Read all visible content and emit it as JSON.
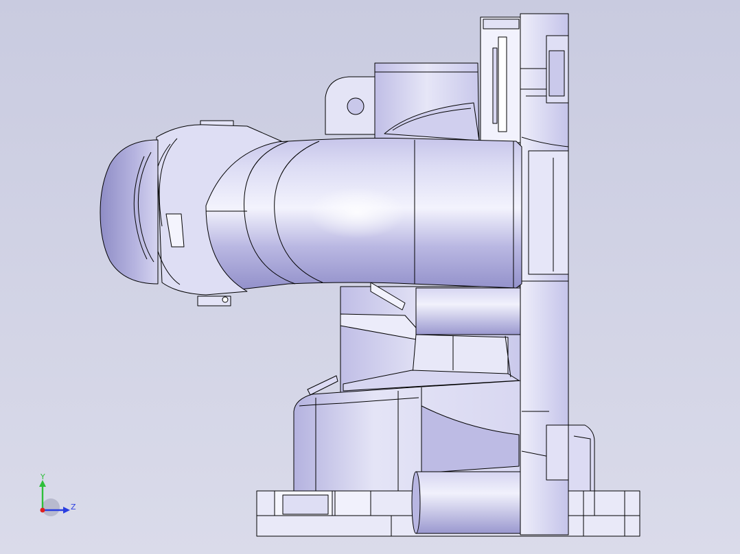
{
  "viewport": {
    "background_top": "#c9cbe0",
    "background_bottom": "#dadbea"
  },
  "model": {
    "fill": "#b8b6e2",
    "fill_light": "#e2e2f5",
    "fill_highlight": "#f6f6ff",
    "fill_shadow": "#7f7dbd",
    "edge": "#000000"
  },
  "axis_triad": {
    "y_label": "Y",
    "z_label": "Z",
    "y_color": "#2fbf3a",
    "z_color": "#2a3ee0",
    "origin_color": "#e02020"
  }
}
